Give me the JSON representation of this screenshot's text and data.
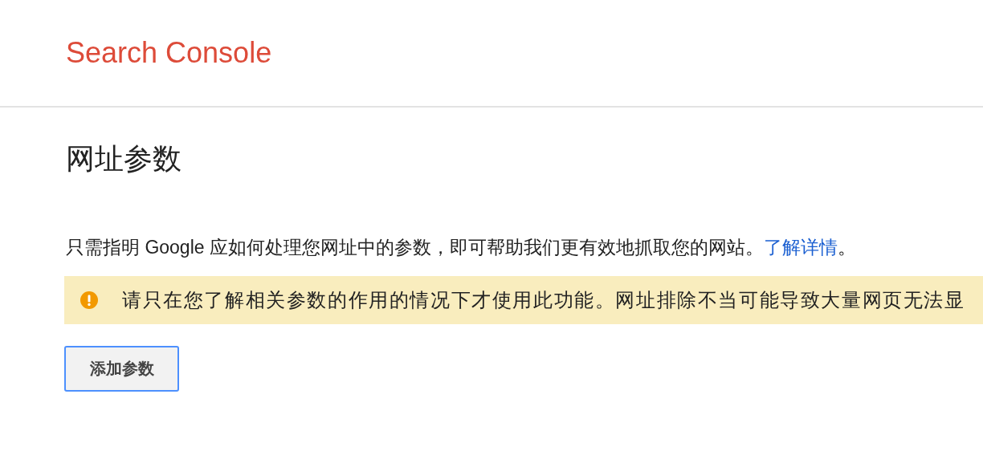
{
  "header": {
    "logo": "Search Console"
  },
  "page_title": "网址参数",
  "description": {
    "text": "只需指明 Google 应如何处理您网址中的参数，即可帮助我们更有效地抓取您的网站。",
    "link": "了解详情",
    "end": "。"
  },
  "warning": {
    "kind": "warning",
    "text": "请只在您了解相关参数的作用的情况下才使用此功能。网址排除不当可能导致大量网页无法显"
  },
  "buttons": [
    "添加参数"
  ]
}
